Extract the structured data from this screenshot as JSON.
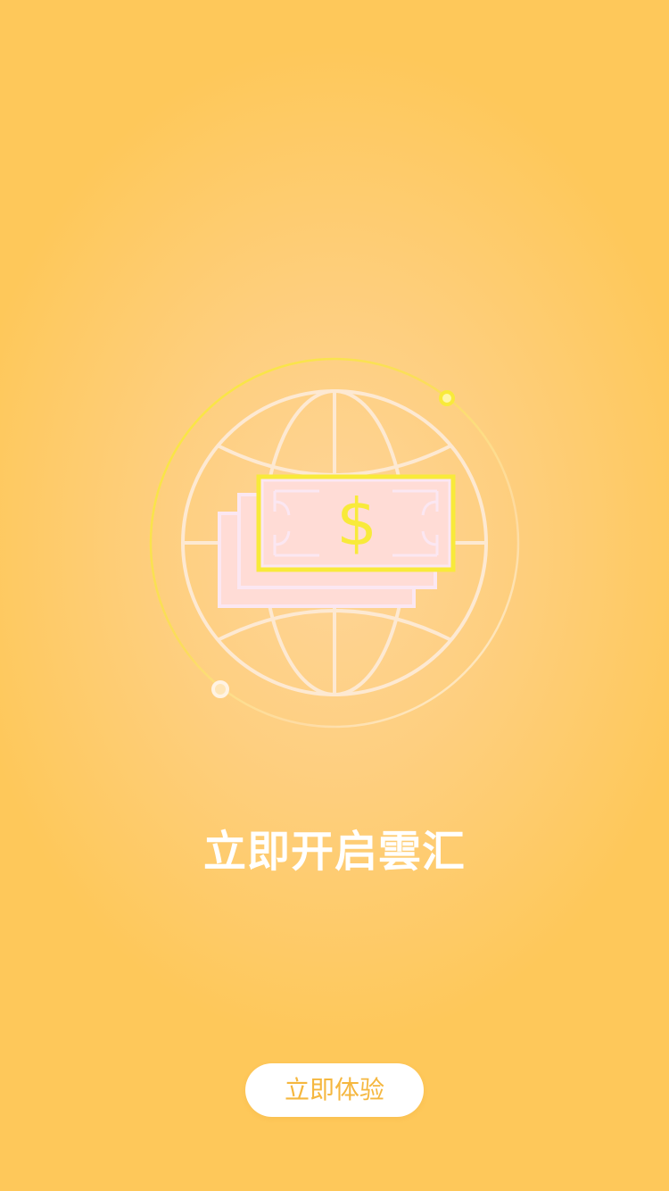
{
  "screen": {
    "headline": "立即开启雲汇",
    "cta_label": "立即体验"
  },
  "illustration": {
    "icon": "globe-money-icon",
    "bill_symbol": "$"
  },
  "colors": {
    "background_center": "#fed598",
    "background_edge": "#fec85a",
    "accent_yellow": "#f8ea3a",
    "bill_fill": "#ffdcd6",
    "button_text": "#f5b73f",
    "headline_text": "#ffffff"
  }
}
